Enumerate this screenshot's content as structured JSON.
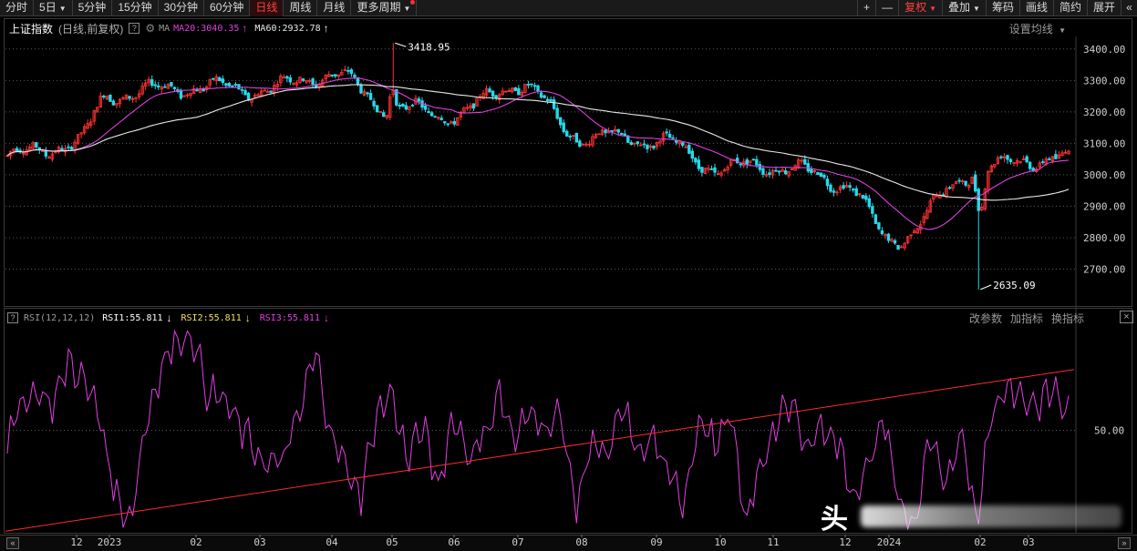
{
  "toolbar": {
    "left": [
      "分时",
      "5日",
      "5分钟",
      "15分钟",
      "30分钟",
      "60分钟",
      "日线",
      "周线",
      "月线",
      "更多周期"
    ],
    "active": "日线",
    "right": [
      "+",
      "—",
      "复权",
      "叠加",
      "筹码",
      "画线",
      "简约",
      "展开"
    ],
    "collapse_icon": "«"
  },
  "header": {
    "title": "上证指数",
    "subtitle": "(日线,前复权)",
    "ma_label": "MA",
    "ma20": "MA20:3040.35",
    "ma60": "MA60:2932.78",
    "settings": "设置均线"
  },
  "rsi_header": {
    "label": "RSI(12,12,12)",
    "rsi1": "RSI1:55.811",
    "rsi2": "RSI2:55.811",
    "rsi3": "RSI3:55.811",
    "actions": [
      "改参数",
      "加指标",
      "换指标"
    ],
    "close": "×"
  },
  "watermark": {
    "text": "头"
  },
  "colors": {
    "up": "#ff3333",
    "down": "#27d9ea",
    "ma20": "#e040e0",
    "ma60": "#e8e8e8",
    "rsi": "#e040e0",
    "trendline": "#ff2a2a",
    "grid": "#5a5a5a"
  },
  "chart_data": [
    {
      "type": "candlestick",
      "title": "上证指数",
      "ylim": [
        2600,
        3440
      ],
      "y_ticks": [
        "3400.00",
        "3300.00",
        "3200.00",
        "3100.00",
        "3000.00",
        "2900.00",
        "2800.00",
        "2700.00"
      ],
      "grid": "dotted-horizontal",
      "annotations": [
        {
          "label": "3418.95",
          "value": 3418.95,
          "month": "2023-05"
        },
        {
          "label": "2635.09",
          "value": 2635.09,
          "month": "2024-02"
        }
      ],
      "monthly_path": [
        {
          "month": "2022-11",
          "close": 3060
        },
        {
          "month": "2022-12",
          "close": 3100
        },
        {
          "month": "2023-01",
          "close": 3255
        },
        {
          "month": "2023-02",
          "close": 3280
        },
        {
          "month": "2023-03",
          "close": 3270
        },
        {
          "month": "2023-04",
          "close": 3320
        },
        {
          "month": "2023-05",
          "close": 3210
        },
        {
          "month": "2023-06",
          "close": 3190
        },
        {
          "month": "2023-07",
          "close": 3290
        },
        {
          "month": "2023-08",
          "close": 3120
        },
        {
          "month": "2023-09",
          "close": 3110
        },
        {
          "month": "2023-10",
          "close": 3020
        },
        {
          "month": "2023-11",
          "close": 3030
        },
        {
          "month": "2023-12",
          "close": 2975
        },
        {
          "month": "2024-01",
          "close": 2790
        },
        {
          "month": "2024-02",
          "close": 3015
        },
        {
          "month": "2024-03",
          "close": 3050
        }
      ],
      "series": [
        {
          "name": "MA20",
          "value": 3040.35
        },
        {
          "name": "MA60",
          "value": 2932.78
        }
      ]
    },
    {
      "type": "line",
      "title": "RSI(12,12,12)",
      "ylim": [
        18,
        82
      ],
      "y_ticks": [
        "50.00"
      ],
      "rsi_path": [
        45,
        60,
        62,
        58,
        72,
        65,
        55,
        30,
        22,
        52,
        70,
        78,
        80,
        62,
        60,
        52,
        45,
        38,
        42,
        55,
        75,
        50,
        38,
        30,
        55,
        62,
        40,
        52,
        32,
        55,
        42,
        48,
        62,
        45,
        58,
        50,
        55,
        25,
        48,
        40,
        58,
        42,
        48,
        35,
        28,
        55,
        45,
        55,
        20,
        40,
        52,
        58,
        45,
        52,
        46,
        30,
        38,
        55,
        26,
        20,
        48,
        30,
        52,
        22,
        55,
        65,
        60,
        58,
        63,
        55
      ],
      "trendline": {
        "start": 18.5,
        "end": 69
      },
      "x_ticks": [
        "12",
        "2023",
        "02",
        "03",
        "04",
        "05",
        "06",
        "07",
        "08",
        "09",
        "10",
        "11",
        "12",
        "2024",
        "02",
        "03"
      ]
    }
  ]
}
